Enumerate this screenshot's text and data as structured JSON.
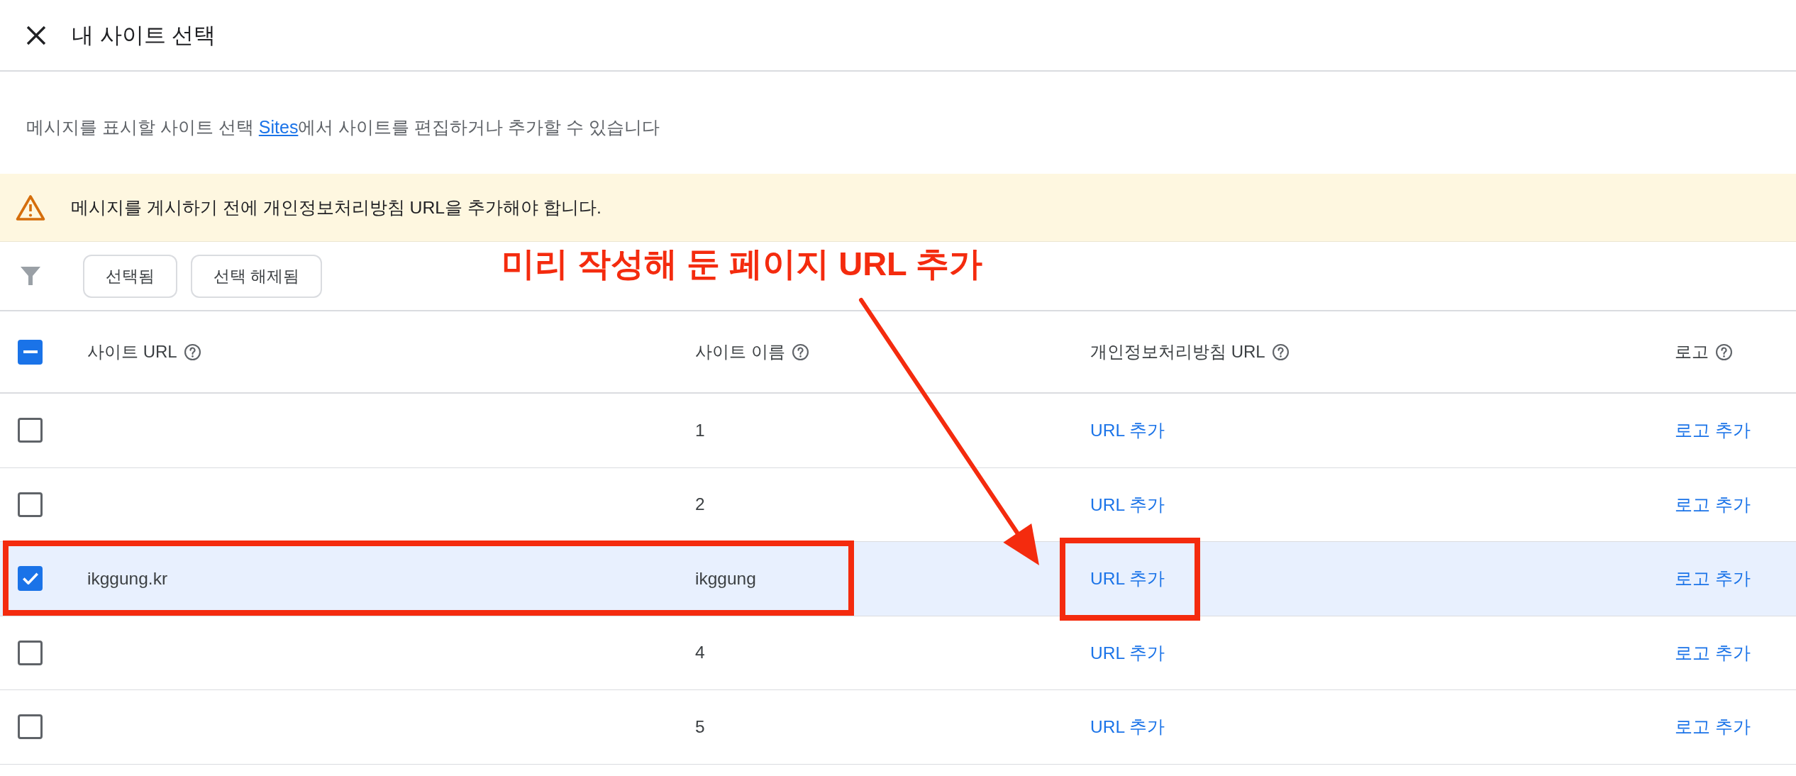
{
  "dialog": {
    "title": "내 사이트 선택"
  },
  "description": {
    "text_before": "메시지를 표시할 사이트 선택 ",
    "link": "Sites",
    "text_after": "에서 사이트를 편집하거나 추가할 수 있습니다"
  },
  "warning": {
    "text": "메시지를 게시하기 전에 개인정보처리방침 URL을 추가해야 합니다."
  },
  "filters": [
    {
      "label": "선택됨",
      "selected": false
    },
    {
      "label": "선택 해제됨",
      "selected": false
    }
  ],
  "table": {
    "header_checkbox": {
      "indeterminate": true
    },
    "columns": [
      {
        "label": "사이트 URL"
      },
      {
        "label": "사이트 이름"
      },
      {
        "label": "개인정보처리방침 URL"
      },
      {
        "label": "로고"
      }
    ],
    "rows": [
      {
        "name": "1",
        "privacy_url": "URL 추가",
        "logo": "로고 추가",
        "checked": false,
        "selected": false,
        "marked": false
      },
      {
        "name": "2",
        "privacy_url": "URL 추가",
        "logo": "로고 추가",
        "checked": false,
        "selected": false,
        "marked": false
      },
      {
        "url": "ikggung.kr",
        "name": "ikggung",
        "privacy_url": "URL 추가",
        "logo": "로고 추가",
        "checked": true,
        "selected": true,
        "marked": true
      },
      {
        "name": "4",
        "privacy_url": "URL 추가",
        "logo": "로고 추가",
        "checked": false,
        "selected": false,
        "marked": false
      },
      {
        "name": "5",
        "privacy_url": "URL 추가",
        "logo": "로고 추가",
        "checked": false,
        "selected": false,
        "marked": false
      }
    ]
  },
  "annotation": {
    "text": "미리 작성해 둔 페이지 URL 추가"
  }
}
